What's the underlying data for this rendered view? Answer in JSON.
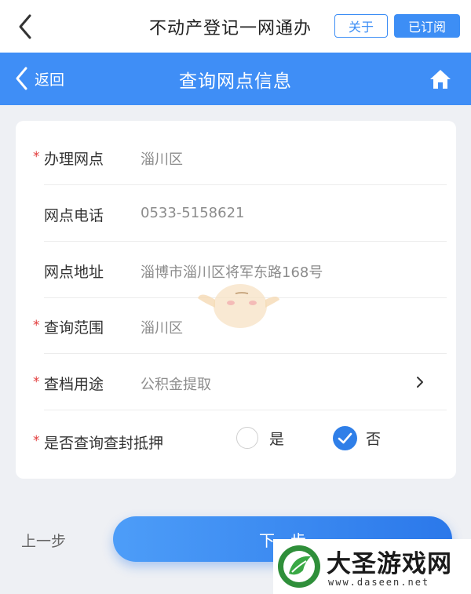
{
  "topbar": {
    "title": "不动产登记一网通办",
    "about_label": "关于",
    "subscribed_label": "已订阅"
  },
  "navbar": {
    "back_label": "返回",
    "title": "查询网点信息"
  },
  "form": {
    "rows": [
      {
        "label": "办理网点",
        "value": "淄川区",
        "required": true
      },
      {
        "label": "网点电话",
        "value": "0533-5158621",
        "required": false
      },
      {
        "label": "网点地址",
        "value": "淄博市淄川区将军东路168号",
        "required": false
      },
      {
        "label": "查询范围",
        "value": "淄川区",
        "required": true
      },
      {
        "label": "查档用途",
        "value": "公积金提取",
        "required": true
      },
      {
        "label": "是否查询查封抵押",
        "value": "",
        "required": true
      }
    ],
    "required_mark": "*",
    "options": {
      "yes_label": "是",
      "no_label": "否",
      "selected": "否"
    }
  },
  "footer": {
    "prev_label": "上一步",
    "next_label": "下一步"
  },
  "watermark": {
    "title": "大圣游戏网",
    "url": "www.daseen.net"
  },
  "colors": {
    "accent": "#3f8ef6",
    "required": "#e23b3b"
  }
}
